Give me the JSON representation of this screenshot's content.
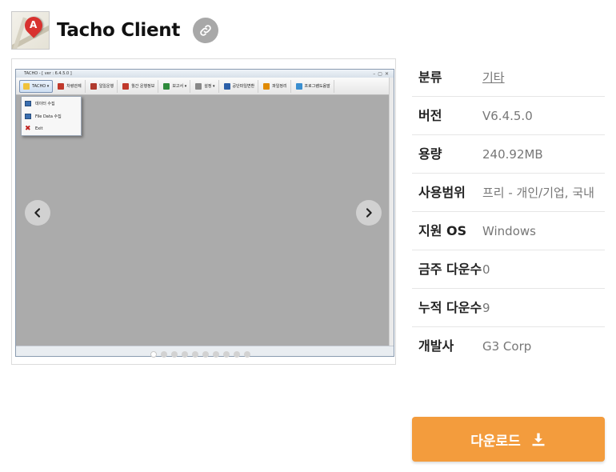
{
  "app": {
    "title": "Tacho Client",
    "icon_letter": "A"
  },
  "screenshot": {
    "window_title": "TACHO - [ ver : 6.4.5.0 ]",
    "toolbar": [
      {
        "label": "TACHO ▾",
        "color": "#f0c23b"
      },
      {
        "label": "차량관제",
        "color": "#c0392b"
      },
      {
        "label": "일일운행",
        "color": "#b03a2e"
      },
      {
        "label": "월간 운행정보",
        "color": "#c0392b"
      },
      {
        "label": "보고서 ▾",
        "color": "#2e8b3c"
      },
      {
        "label": "설정 ▾",
        "color": "#888888"
      },
      {
        "label": "공단파일변환",
        "color": "#2b5fa8"
      },
      {
        "label": "파일정리",
        "color": "#e08a00"
      },
      {
        "label": "프로그램도움말",
        "color": "#3b8fd0"
      }
    ],
    "menu": [
      {
        "label": "데이터 수집",
        "icon": "data-icon"
      },
      {
        "label": "File Data 수집",
        "icon": "file-icon"
      },
      {
        "label": "Exit",
        "icon": "exit-icon"
      }
    ],
    "slide_count": 10,
    "active_slide": 1
  },
  "info": {
    "rows": [
      {
        "label": "분류",
        "value": "기타",
        "link": true
      },
      {
        "label": "버전",
        "value": "V6.4.5.0"
      },
      {
        "label": "용량",
        "value": "240.92MB"
      },
      {
        "label": "사용범위",
        "value": "프리 - 개인/기업, 국내"
      },
      {
        "label": "지원 OS",
        "value": "Windows"
      },
      {
        "label": "금주 다운수",
        "value": "0"
      },
      {
        "label": "누적 다운수",
        "value": "9"
      },
      {
        "label": "개발사",
        "value": "G3 Corp"
      }
    ]
  },
  "download": {
    "label": "다운로드"
  },
  "colors": {
    "accent": "#f39c3d",
    "link_button": "#a8a8a8"
  }
}
